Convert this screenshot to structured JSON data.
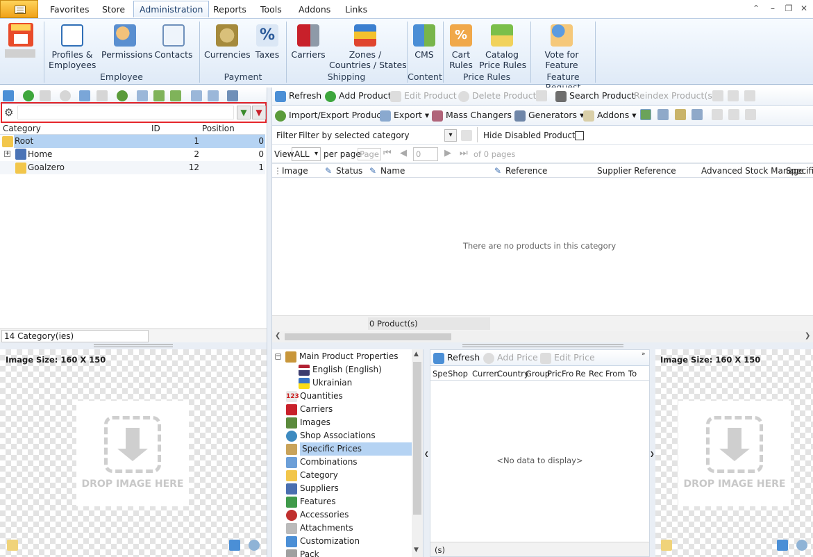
{
  "menu": {
    "tabs": [
      "Favorites",
      "Store",
      "Administration",
      "Reports",
      "Tools",
      "Addons",
      "Links"
    ],
    "active_tab": "Administration"
  },
  "ribbon": {
    "buttons": {
      "profiles": "Profiles &\nEmployees",
      "permissions": "Permissions",
      "contacts": "Contacts",
      "currencies": "Currencies",
      "taxes": "Taxes",
      "carriers": "Carriers",
      "zones": "Zones /\nCountries / States",
      "cms": "CMS",
      "cart_rules": "Cart\nRules",
      "catalog_rules": "Catalog\nPrice Rules",
      "vote": "Vote for\nFeature"
    },
    "groups": {
      "employee": "Employee",
      "payment": "Payment",
      "shipping": "Shipping",
      "content": "Content",
      "price_rules": "Price Rules",
      "feature_request": "Feature Request"
    }
  },
  "category_panel": {
    "columns": [
      "Category",
      "ID",
      "Position"
    ],
    "rows": [
      {
        "name": "Root",
        "id": "1",
        "position": "0"
      },
      {
        "name": "Home",
        "id": "2",
        "position": "0"
      },
      {
        "name": "Goalzero",
        "id": "12",
        "position": "1"
      }
    ],
    "footer": "14 Category(ies)"
  },
  "product_toolbar": {
    "refresh": "Refresh",
    "add_product": "Add Product",
    "edit_product": "Edit Product",
    "delete_product": "Delete Product",
    "search_product": "Search Product",
    "reindex": "Reindex Product(s)",
    "import_export": "Import/Export Products",
    "export": "Export",
    "mass_changers": "Mass Changers",
    "generators": "Generators",
    "addons": "Addons"
  },
  "filter_bar": {
    "label": "Filter",
    "value": "Filter by selected category",
    "hide_disabled": "Hide Disabled Products"
  },
  "pager": {
    "view_label": "View",
    "view_value": "ALL",
    "per_page": "per page",
    "page_label": "Page",
    "page_value": "0",
    "of_pages": "of 0 pages"
  },
  "product_grid": {
    "columns": [
      "Image",
      "Status",
      "Name",
      "Reference",
      "Supplier Reference",
      "Advanced Stock Manage",
      "Specific"
    ],
    "empty": "There are no products in this category",
    "footer": "0 Product(s)"
  },
  "image_panels": {
    "size_label": "Image Size: 160 X 150",
    "drop_text": "DROP IMAGE HERE"
  },
  "properties_tree": {
    "items": [
      "Main Product Properties",
      "English (English)",
      "Ukrainian",
      "Quantities",
      "Carriers",
      "Images",
      "Shop Associations",
      "Specific Prices",
      "Combinations",
      "Category",
      "Suppliers",
      "Features",
      "Accessories",
      "Attachments",
      "Customization",
      "Pack"
    ],
    "selected": "Specific Prices"
  },
  "specific_prices": {
    "refresh": "Refresh",
    "add_price": "Add Price",
    "edit_price": "Edit Price",
    "columns": [
      "Spe",
      "Shop",
      "Curren",
      "Country",
      "Group",
      "Pric",
      "Fro",
      "Re",
      "Rec",
      "From",
      "To"
    ],
    "empty": "<No data to display>",
    "footer": "(s)"
  }
}
